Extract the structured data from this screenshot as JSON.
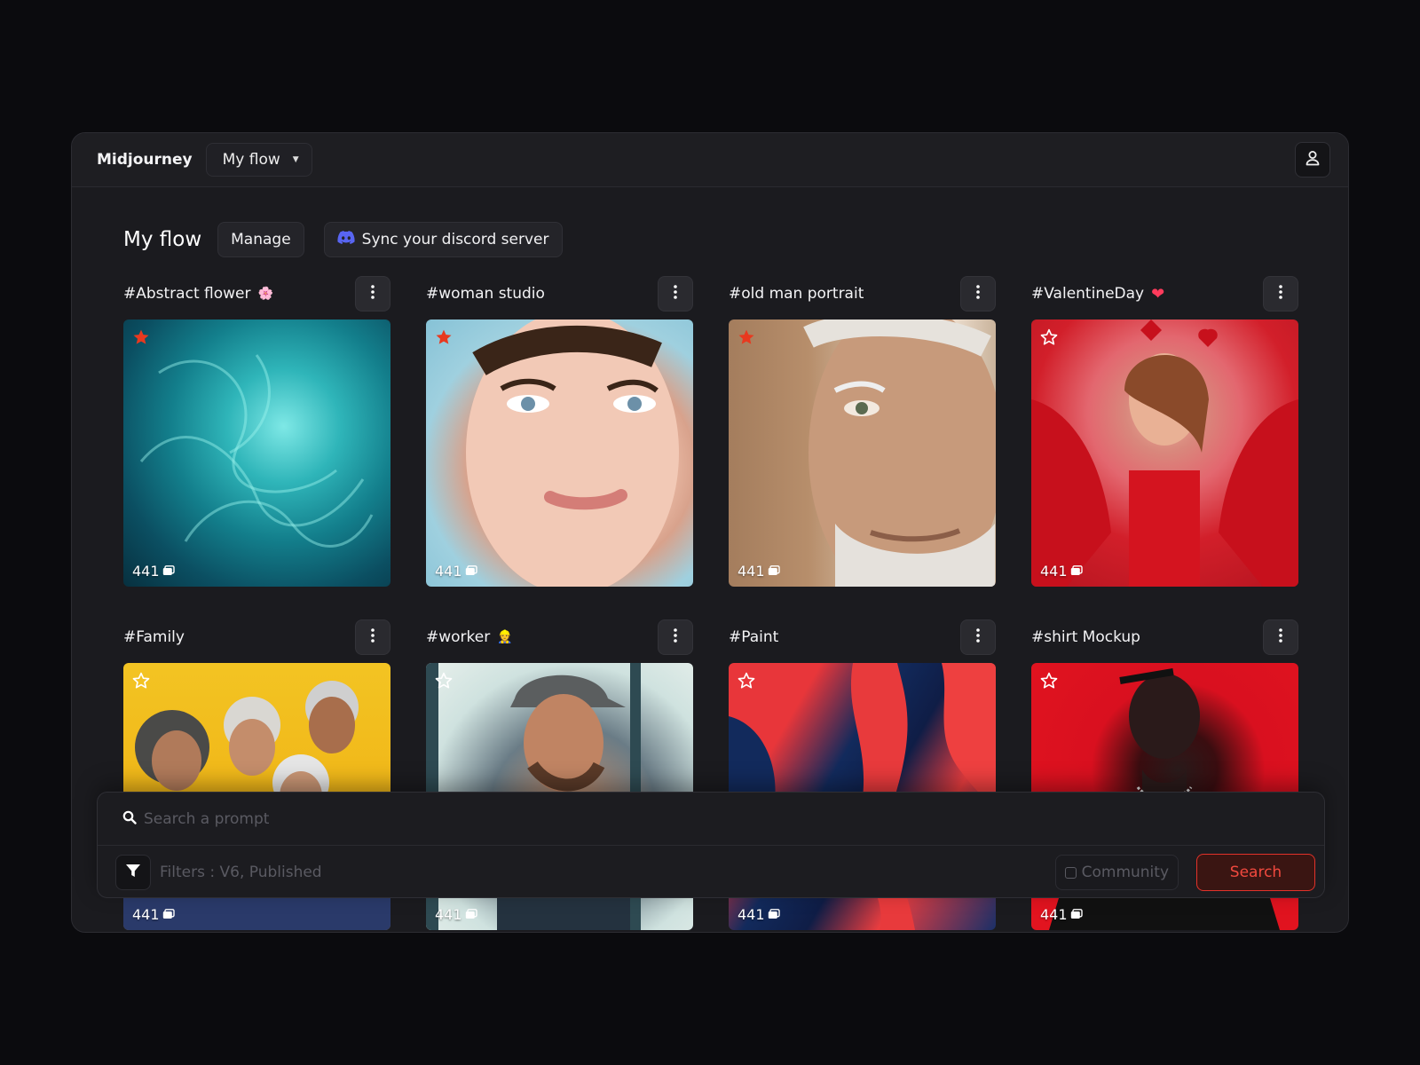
{
  "app": {
    "brand": "Midjourney",
    "flow_select": "My flow"
  },
  "page": {
    "title": "My flow",
    "manage_label": "Manage",
    "sync_label": "Sync your discord server"
  },
  "cards": [
    {
      "title": "#Abstract flower",
      "emoji": "🌸",
      "count": "441",
      "starred": true
    },
    {
      "title": "#woman studio",
      "emoji": "",
      "count": "441",
      "starred": true
    },
    {
      "title": "#old man portrait",
      "emoji": "",
      "count": "441",
      "starred": true
    },
    {
      "title": "#ValentineDay",
      "emoji": "❤",
      "count": "441",
      "starred": false
    },
    {
      "title": "#Family",
      "emoji": "",
      "count": "441",
      "starred": false
    },
    {
      "title": "#worker",
      "emoji": "👷",
      "count": "441",
      "starred": false
    },
    {
      "title": "#Paint",
      "emoji": "",
      "count": "441",
      "starred": false
    },
    {
      "title": "#shirt Mockup",
      "emoji": "",
      "count": "441",
      "starred": false
    }
  ],
  "search": {
    "placeholder": "Search a prompt",
    "filters": "Filters : V6, Published",
    "community_label": "Community",
    "search_label": "Search"
  },
  "colors": {
    "accent": "#e2322a",
    "star": "#e8391f",
    "discord": "#5865f2"
  },
  "icons": [
    "user-icon",
    "chevron-down-icon",
    "discord-icon",
    "more-vertical-icon",
    "star-icon",
    "images-icon",
    "search-icon",
    "filter-icon",
    "checkbox-icon"
  ]
}
